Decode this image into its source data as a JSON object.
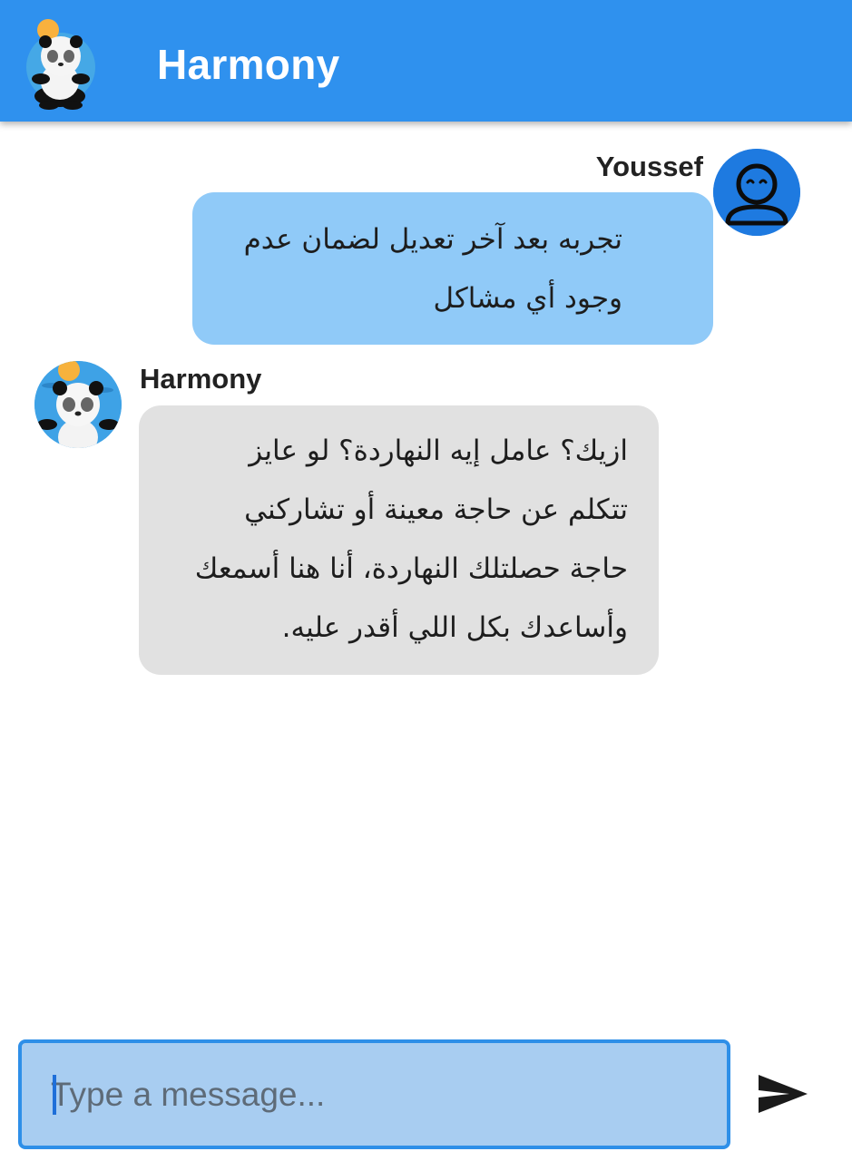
{
  "app_bar": {
    "title": "Harmony",
    "logo_icon": "panda-logo-icon",
    "background_color": "#2f91ee"
  },
  "messages": [
    {
      "sender": "Youssef",
      "role": "user",
      "avatar_icon": "user-face-icon",
      "lines": [
        "تجربه بعد آخر تعديل لضمان عدم",
        "وجود أي مشاكل"
      ],
      "bubble_color": "#90caf8"
    },
    {
      "sender": "Harmony",
      "role": "bot",
      "avatar_icon": "panda-avatar-icon",
      "lines": [
        "ازيك؟ عامل إيه النهاردة؟ لو عايز",
        "تتكلم عن حاجة معينة أو تشاركني",
        "حاجة حصلتلك النهاردة، أنا هنا أسمعك",
        "وأساعدك بكل اللي أقدر عليه."
      ],
      "bubble_color": "#e1e1e1"
    }
  ],
  "composer": {
    "value": "",
    "placeholder": "Type a message...",
    "send_icon": "send-icon"
  }
}
